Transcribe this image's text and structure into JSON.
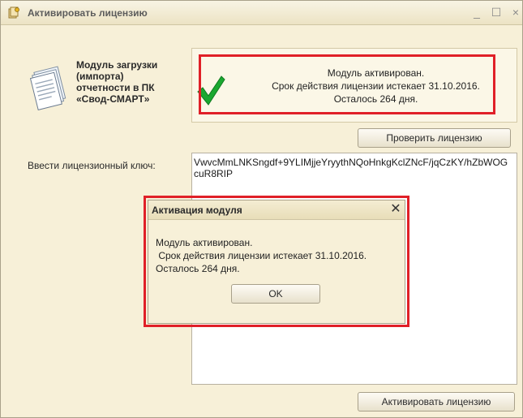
{
  "window": {
    "title": "Активировать лицензию",
    "icon": "license-key-icon",
    "minimize_glyph": "_",
    "maximize_glyph": "☐",
    "close_glyph": "×"
  },
  "module": {
    "icon": "document-stack-icon",
    "name_lines": [
      "Модуль загрузки",
      "(импорта)",
      "отчетности в ПК",
      "«Свод-СМАРТ»"
    ]
  },
  "status": {
    "icon": "checkmark-icon",
    "lines": [
      "Модуль активирован.",
      "Срок действия лицензии истекает 31.10.2016.",
      "Осталось 264 дня."
    ]
  },
  "buttons": {
    "check_license": "Проверить лицензию",
    "activate_license": "Активировать лицензию"
  },
  "key": {
    "label": "Ввести лицензионный ключ:",
    "value": "VwvcMmLNKSngdf+9YLIMjjeYryythNQoHnkgKclZNcF/jqCzKY/hZbWOGcuR8RIP"
  },
  "dialog": {
    "title": "Активация модуля",
    "close_glyph": "✕",
    "lines": [
      "Модуль активирован.",
      " Срок действия лицензии истекает 31.10.2016.",
      "Осталось 264 дня."
    ],
    "ok_label": "OK"
  },
  "colors": {
    "window_bg": "#f7f0d8",
    "highlight": "#e02028",
    "checkmark": "#1aa830"
  }
}
